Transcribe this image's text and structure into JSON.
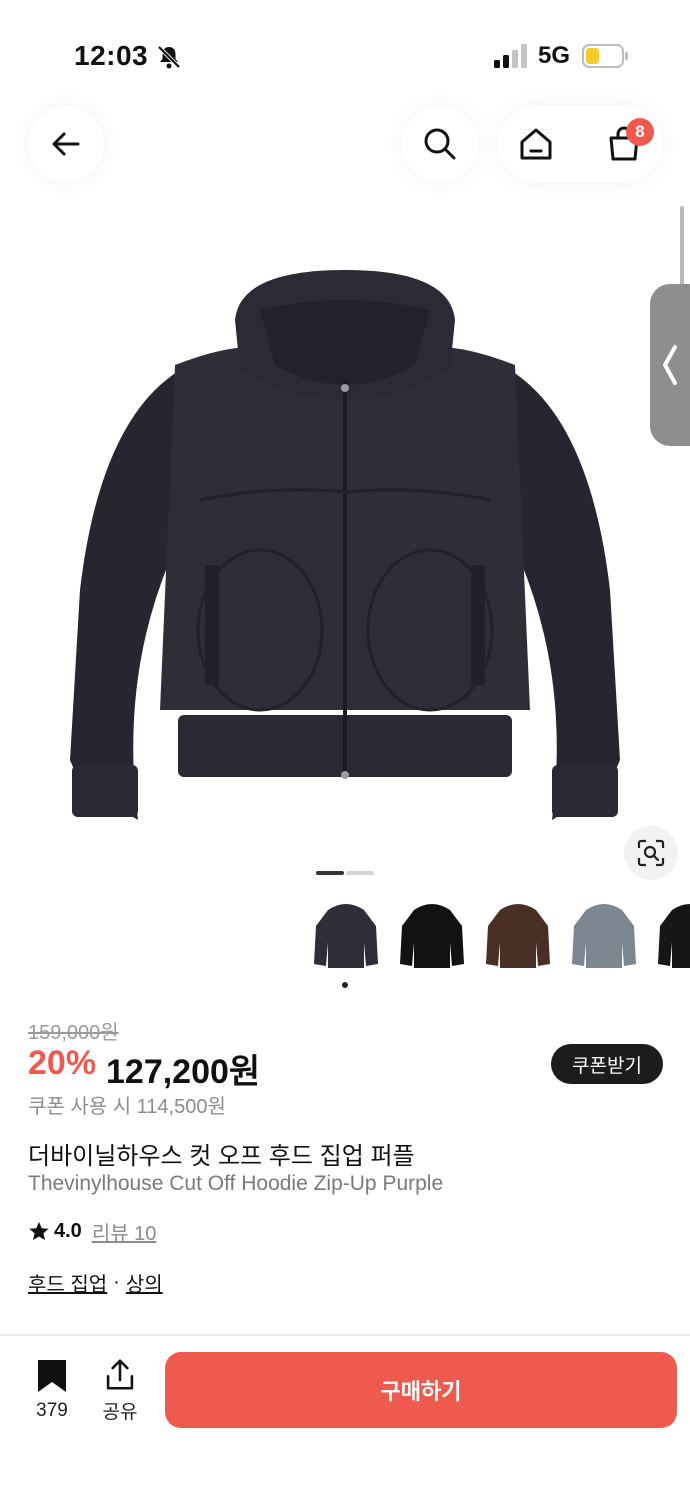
{
  "status_bar": {
    "time": "12:03",
    "network": "5G"
  },
  "nav": {
    "cart_count": "8"
  },
  "product": {
    "original_price": "159,000원",
    "discount_rate": "20%",
    "sale_price": "127,200원",
    "coupon_button": "쿠폰받기",
    "coupon_price": "쿠폰 사용 시 114,500원",
    "title_ko": "더바이닐하우스 컷 오프 후드 집업 퍼플",
    "title_en": "Thevinylhouse Cut Off Hoodie Zip-Up Purple",
    "rating": "4.0",
    "review_link": "리뷰 10",
    "categories": [
      "후드 집업",
      "상의"
    ],
    "category_separator": "·"
  },
  "gallery": {
    "active_image": 1,
    "image_count": 2
  },
  "colors": [
    {
      "name": "purple",
      "hex": "#2e2d38"
    },
    {
      "name": "black",
      "hex": "#121212"
    },
    {
      "name": "brown",
      "hex": "#4a2f24"
    },
    {
      "name": "gray",
      "hex": "#7d8791"
    },
    {
      "name": "black-2",
      "hex": "#161616"
    }
  ],
  "bottom_bar": {
    "bookmark_count": "379",
    "share_label": "공유",
    "buy_button": "구매하기"
  },
  "theme": {
    "accent": "#ef5a4f",
    "dark": "#1c1c1c"
  }
}
